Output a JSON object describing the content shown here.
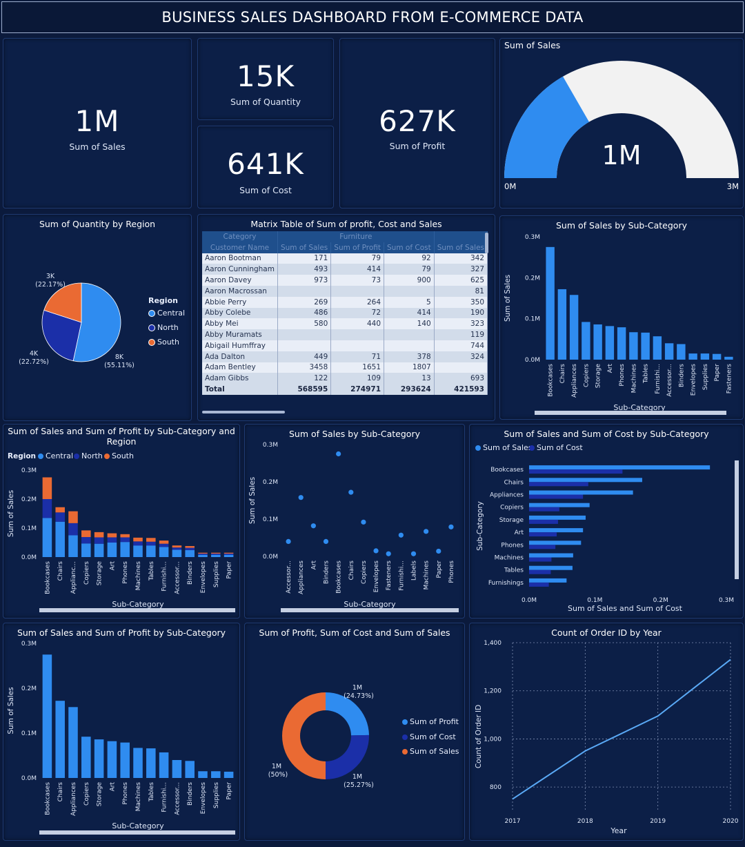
{
  "title": "BUSINESS SALES DASHBOARD FROM E-COMMERCE DATA",
  "colors": {
    "central": "#2f8cf0",
    "north": "#1b2fa8",
    "south": "#ea6a33",
    "bar": "#2f8cf0",
    "cost": "#1b2fa8"
  },
  "kpis": {
    "sales": {
      "value": "1M",
      "label": "Sum of Sales"
    },
    "quantity": {
      "value": "15K",
      "label": "Sum of Quantity"
    },
    "cost": {
      "value": "641K",
      "label": "Sum of Cost"
    },
    "profit": {
      "value": "627K",
      "label": "Sum of Profit"
    }
  },
  "gauge": {
    "title": "Sum of Sales",
    "value_label": "1M",
    "min_label": "0M",
    "max_label": "3M",
    "value": 1.0,
    "min": 0,
    "max": 3
  },
  "matrix": {
    "title": "Matrix Table of Sum of profit, Cost and Sales",
    "header1": [
      "Category",
      "Furniture",
      ""
    ],
    "header2": [
      "Customer Name",
      "Sum of Sales",
      "Sum of Profit",
      "Sum of Cost",
      "Sum of Sales"
    ],
    "rows": [
      [
        "Aaron Bootman",
        "171",
        "79",
        "92",
        "342"
      ],
      [
        "Aaron Cunningham",
        "493",
        "414",
        "79",
        "327"
      ],
      [
        "Aaron Davey",
        "973",
        "73",
        "900",
        "625"
      ],
      [
        "Aaron Macrossan",
        "",
        "",
        "",
        "81"
      ],
      [
        "Abbie Perry",
        "269",
        "264",
        "5",
        "350"
      ],
      [
        "Abby Colebe",
        "486",
        "72",
        "414",
        "190"
      ],
      [
        "Abby Mei",
        "580",
        "440",
        "140",
        "323"
      ],
      [
        "Abby Muramats",
        "",
        "",
        "",
        "119"
      ],
      [
        "Abigail Humffray",
        "",
        "",
        "",
        "744"
      ],
      [
        "Ada Dalton",
        "449",
        "71",
        "378",
        "324"
      ],
      [
        "Adam Bentley",
        "3458",
        "1651",
        "1807",
        ""
      ],
      [
        "Adam Gibbs",
        "122",
        "109",
        "13",
        "693"
      ]
    ],
    "total": [
      "Total",
      "568595",
      "274971",
      "293624",
      "421593"
    ]
  },
  "pie_region": {
    "title": "Sum of Quantity by Region",
    "legend_title": "Region",
    "slices": [
      {
        "name": "Central",
        "value": 8,
        "label": "8K",
        "pct": "(55.11%)"
      },
      {
        "name": "North",
        "value": 4,
        "label": "4K",
        "pct": "(22.72%)"
      },
      {
        "name": "South",
        "value": 3,
        "label": "3K",
        "pct": "(22.17%)"
      }
    ]
  },
  "chart_data": [
    {
      "id": "sales_by_subcat_top",
      "type": "bar",
      "title": "Sum of Sales by Sub-Category",
      "xlabel": "Sub-Category",
      "ylabel": "Sum of Sales",
      "yticks": [
        "0.0M",
        "0.1M",
        "0.2M",
        "0.3M"
      ],
      "ylim": [
        0,
        0.3
      ],
      "categories": [
        "Bookcases",
        "Chairs",
        "Appliances",
        "Copiers",
        "Storage",
        "Art",
        "Phones",
        "Machines",
        "Tables",
        "Furnishi...",
        "Accessor...",
        "Binders",
        "Envelopes",
        "Supplies",
        "Paper",
        "Fasteners"
      ],
      "values": [
        0.275,
        0.172,
        0.158,
        0.092,
        0.086,
        0.082,
        0.079,
        0.067,
        0.066,
        0.057,
        0.04,
        0.038,
        0.015,
        0.015,
        0.014,
        0.007
      ]
    },
    {
      "id": "stacked_region",
      "type": "bar",
      "title": "Sum of Sales and Sum of Profit by Sub-Category and Region",
      "legend_title": "Region",
      "xlabel": "Sub-Category",
      "ylabel": "Sum of Sales",
      "yticks": [
        "0.0M",
        "0.1M",
        "0.2M",
        "0.3M"
      ],
      "ylim": [
        0,
        0.3
      ],
      "categories": [
        "Bookcases",
        "Chairs",
        "Applianc...",
        "Copiers",
        "Storage",
        "Art",
        "Phones",
        "Machines",
        "Tables",
        "Furnishi...",
        "Accessor...",
        "Binders",
        "Envelopes",
        "Supplies",
        "Paper"
      ],
      "series": [
        {
          "name": "Central",
          "values": [
            0.135,
            0.122,
            0.075,
            0.047,
            0.046,
            0.05,
            0.052,
            0.04,
            0.04,
            0.035,
            0.025,
            0.024,
            0.008,
            0.008,
            0.008
          ]
        },
        {
          "name": "North",
          "values": [
            0.065,
            0.032,
            0.042,
            0.022,
            0.022,
            0.018,
            0.016,
            0.014,
            0.013,
            0.011,
            0.008,
            0.008,
            0.004,
            0.004,
            0.004
          ]
        },
        {
          "name": "South",
          "values": [
            0.075,
            0.018,
            0.041,
            0.023,
            0.018,
            0.014,
            0.011,
            0.013,
            0.013,
            0.011,
            0.007,
            0.006,
            0.003,
            0.003,
            0.003
          ]
        }
      ]
    },
    {
      "id": "scatter_subcat",
      "type": "scatter",
      "title": "Sum of Sales by Sub-Category",
      "xlabel": "Sub-Category",
      "ylabel": "Sum of Sales",
      "yticks": [
        "0.0M",
        "0.1M",
        "0.2M",
        "0.3M"
      ],
      "ylim": [
        0,
        0.3
      ],
      "categories": [
        "Accessor...",
        "Appliances",
        "Art",
        "Binders",
        "Bookcases",
        "Chairs",
        "Copiers",
        "Envelopes",
        "Fasteners",
        "Furnishi...",
        "Labels",
        "Machines",
        "Paper",
        "Phones"
      ],
      "values": [
        0.04,
        0.158,
        0.082,
        0.04,
        0.275,
        0.172,
        0.092,
        0.015,
        0.007,
        0.057,
        0.007,
        0.067,
        0.014,
        0.079
      ]
    },
    {
      "id": "hbar_sales_cost",
      "type": "bar",
      "title": "Sum of Sales and Sum of Cost by Sub-Category",
      "xlabel": "Sum of Sales and Sum of Cost",
      "ylabel": "Sub-Category",
      "xticks": [
        "0.0M",
        "0.1M",
        "0.2M",
        "0.3M"
      ],
      "xlim": [
        0,
        0.3
      ],
      "categories": [
        "Bookcases",
        "Chairs",
        "Appliances",
        "Copiers",
        "Storage",
        "Art",
        "Phones",
        "Machines",
        "Tables",
        "Furnishings"
      ],
      "series": [
        {
          "name": "Sum of Sales",
          "values": [
            0.275,
            0.172,
            0.158,
            0.092,
            0.086,
            0.082,
            0.079,
            0.067,
            0.066,
            0.057
          ]
        },
        {
          "name": "Sum of Cost",
          "values": [
            0.142,
            0.09,
            0.082,
            0.046,
            0.044,
            0.042,
            0.04,
            0.034,
            0.033,
            0.03
          ]
        }
      ]
    },
    {
      "id": "sales_by_subcat_bottom",
      "type": "bar",
      "title": "Sum of Sales and Sum of Profit by Sub-Category",
      "xlabel": "Sub-Category",
      "ylabel": "Sum of Sales",
      "yticks": [
        "0.0M",
        "0.1M",
        "0.2M",
        "0.3M"
      ],
      "ylim": [
        0,
        0.3
      ],
      "categories": [
        "Bookcases",
        "Chairs",
        "Appliances",
        "Copiers",
        "Storage",
        "Art",
        "Phones",
        "Machines",
        "Tables",
        "Furnishi...",
        "Accessor...",
        "Binders",
        "Envelopes",
        "Supplies",
        "Paper"
      ],
      "values": [
        0.275,
        0.172,
        0.158,
        0.092,
        0.086,
        0.082,
        0.079,
        0.067,
        0.066,
        0.057,
        0.04,
        0.038,
        0.015,
        0.015,
        0.014
      ]
    },
    {
      "id": "donut_totals",
      "type": "pie",
      "title": "Sum of Profit, Sum of Cost and Sum of Sales",
      "slices": [
        {
          "name": "Sum of Profit",
          "value": 24.73,
          "label": "1M",
          "pct": "(24.73%)"
        },
        {
          "name": "Sum of Cost",
          "value": 25.27,
          "label": "1M",
          "pct": "(25.27%)"
        },
        {
          "name": "Sum of Sales",
          "value": 50,
          "label": "1M",
          "pct": "(50%)"
        }
      ]
    },
    {
      "id": "orders_by_year",
      "type": "line",
      "title": "Count of Order ID by Year",
      "xlabel": "Year",
      "ylabel": "Count of Order ID",
      "x": [
        "2017",
        "2018",
        "2019",
        "2020"
      ],
      "values": [
        750,
        950,
        1095,
        1330
      ],
      "yticks": [
        "800",
        "1,000",
        "1,200",
        "1,400"
      ],
      "ylim": [
        700,
        1400
      ]
    }
  ]
}
